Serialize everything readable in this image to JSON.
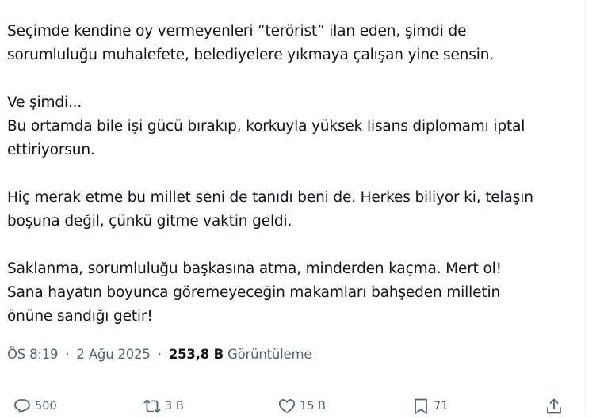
{
  "tweet": {
    "paragraphs": [
      {
        "lines": [
          "Seçimde kendine oy vermeyenleri “terörist” ilan eden, şimdi de",
          "sorumluluğu muhalefete, belediyelere yıkmaya çalışan yine sensin."
        ]
      },
      {
        "lines": [
          "Ve şimdi...",
          "Bu ortamda bile işi gücü bırakıp, korkuyla yüksek lisans diplomamı iptal",
          "ettiriyorsun."
        ]
      },
      {
        "lines": [
          "Hiç merak etme bu millet seni de tanıdı beni de. Herkes biliyor ki, telaşın",
          "boşuna değil, çünkü gitme vaktin geldi."
        ]
      },
      {
        "lines": [
          "Saklanma, sorumluluğu başkasına atma, minderden kaçma. Mert ol!",
          "Sana hayatın boyunca göremeyeceğin makamları bahşeden milletin",
          "önüne sandığı getir!"
        ]
      }
    ]
  },
  "meta": {
    "time": "ÖS 8:19",
    "separator": "·",
    "date": "2 Ağu 2025",
    "views_count": "253,8 B",
    "views_label": "Görüntüleme"
  },
  "actions": {
    "reply": {
      "icon": "reply-icon",
      "count": "500"
    },
    "repost": {
      "icon": "repost-icon",
      "count": "3 B"
    },
    "like": {
      "icon": "heart-icon",
      "count": "15 B"
    },
    "bookmark": {
      "icon": "bookmark-icon",
      "count": "71"
    },
    "share": {
      "icon": "share-icon"
    }
  },
  "colors": {
    "text_primary": "#0f1419",
    "text_secondary": "#536471",
    "divider": "#eff3f4",
    "background": "#ffffff"
  }
}
